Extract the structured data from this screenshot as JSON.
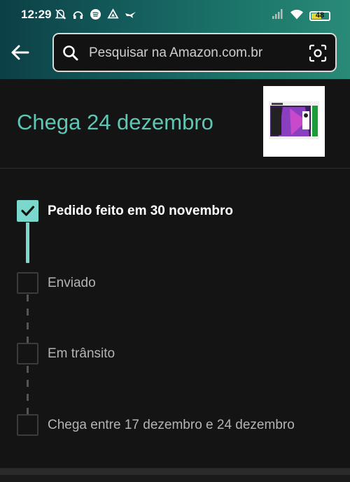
{
  "status_bar": {
    "time": "12:29",
    "battery": "48"
  },
  "search": {
    "placeholder": "Pesquisar na Amazon.com.br"
  },
  "order": {
    "arrival_title": "Chega 24 dezembro",
    "product_image": "xbox-series-s-fortnite-bundle",
    "steps": [
      {
        "label": "Pedido feito em 30 novembro",
        "done": true
      },
      {
        "label": "Enviado",
        "done": false
      },
      {
        "label": "Em trânsito",
        "done": false
      },
      {
        "label": "Chega entre 17 dezembro e 24 dezembro",
        "done": false
      }
    ]
  },
  "colors": {
    "accent": "#7ad9cc",
    "title_teal": "#5ec6b4",
    "background": "#141414",
    "header_start": "#0b3f45",
    "header_end": "#2a8a78"
  }
}
